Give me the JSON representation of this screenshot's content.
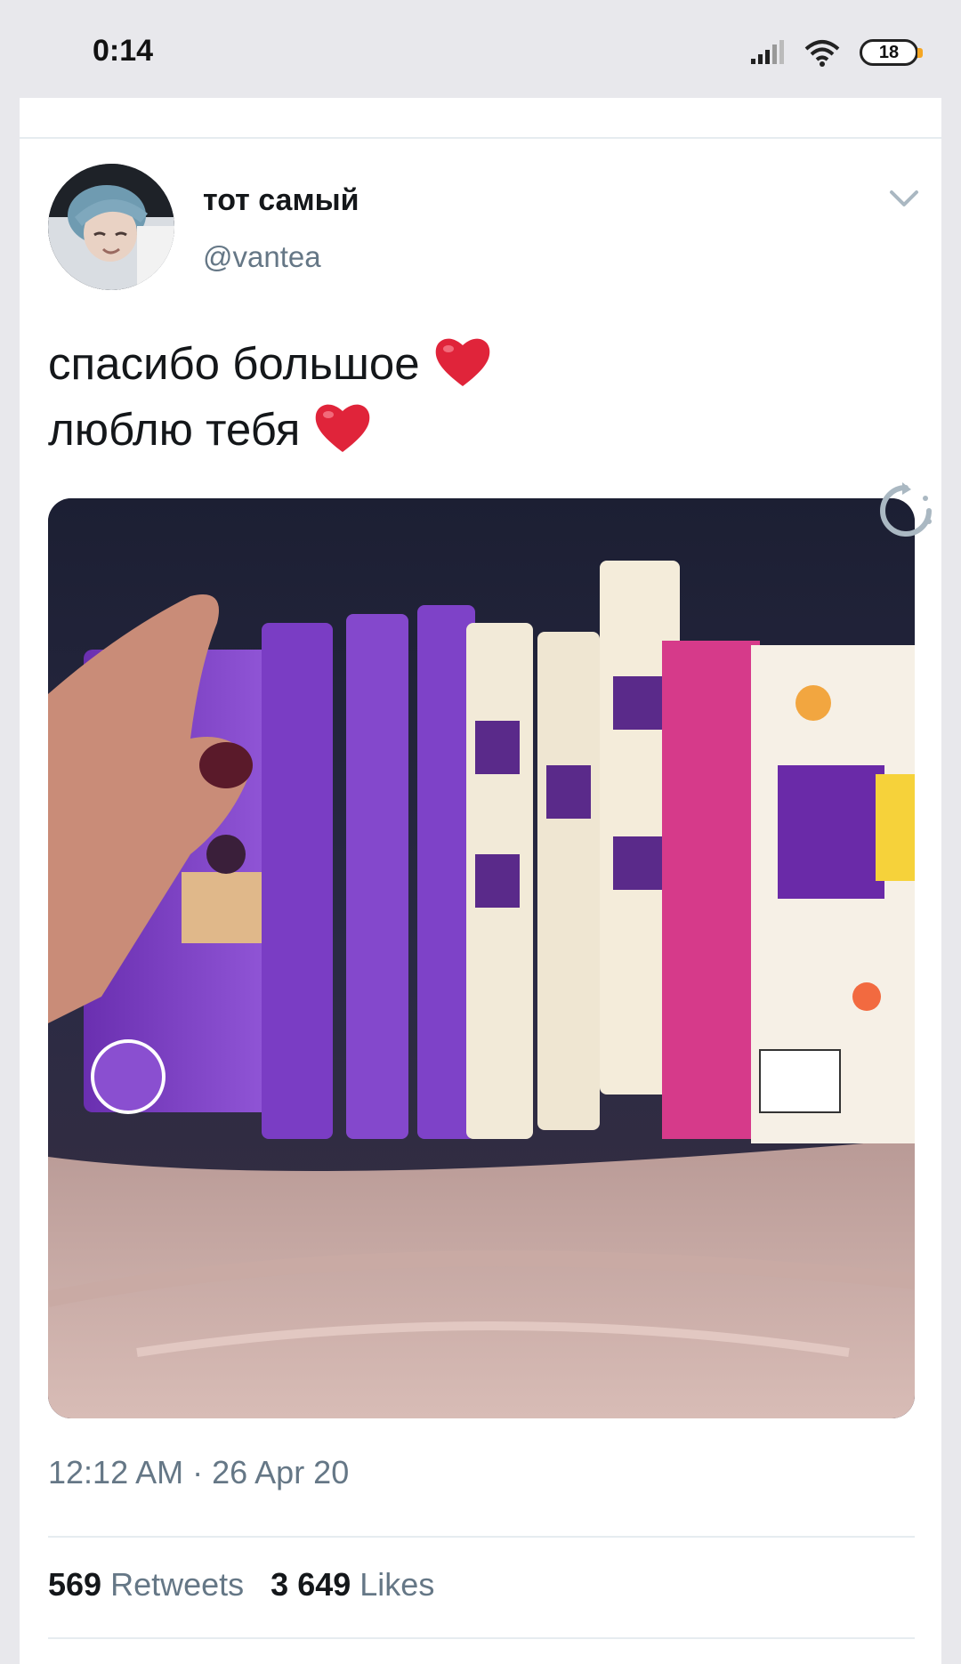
{
  "status_bar": {
    "time": "0:14",
    "battery": "18",
    "icons": [
      "signal-icon",
      "wifi-icon",
      "battery-icon"
    ]
  },
  "tweet": {
    "display_name": "тот самый",
    "handle": "@vantea",
    "text_lines": [
      "спасибо большое",
      "люблю тебя"
    ],
    "emoji": "heart-emoji",
    "timestamp": "12:12 AM · 26 Apr 20",
    "retweets_count": "569",
    "retweets_label": "Retweets",
    "likes_count": "3 649",
    "likes_label": "Likes"
  },
  "colors": {
    "text_primary": "#14171a",
    "text_secondary": "#657786",
    "divider": "#e6ecf0",
    "heart": "#e0243a"
  }
}
